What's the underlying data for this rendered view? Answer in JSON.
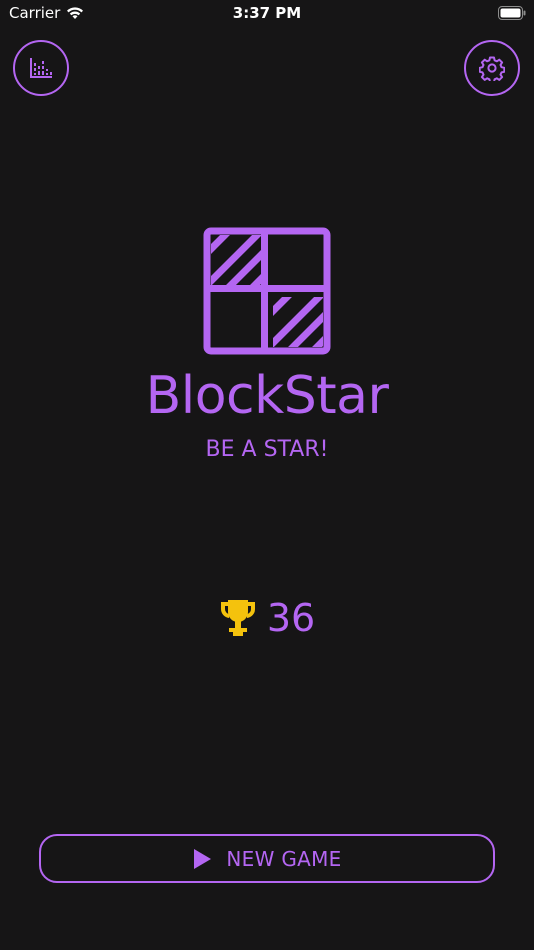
{
  "status_bar": {
    "carrier": "Carrier",
    "time": "3:37 PM"
  },
  "header": {
    "left_icon": "stats-icon",
    "right_icon": "gear-icon"
  },
  "app": {
    "title": "BlockStar",
    "tagline": "BE A STAR!"
  },
  "high_score": {
    "icon": "trophy-icon",
    "value": "36"
  },
  "new_game": {
    "icon": "play-icon",
    "label": "NEW GAME"
  },
  "colors": {
    "accent": "#b466f2",
    "trophy": "#f4c20d",
    "background": "#161516"
  }
}
